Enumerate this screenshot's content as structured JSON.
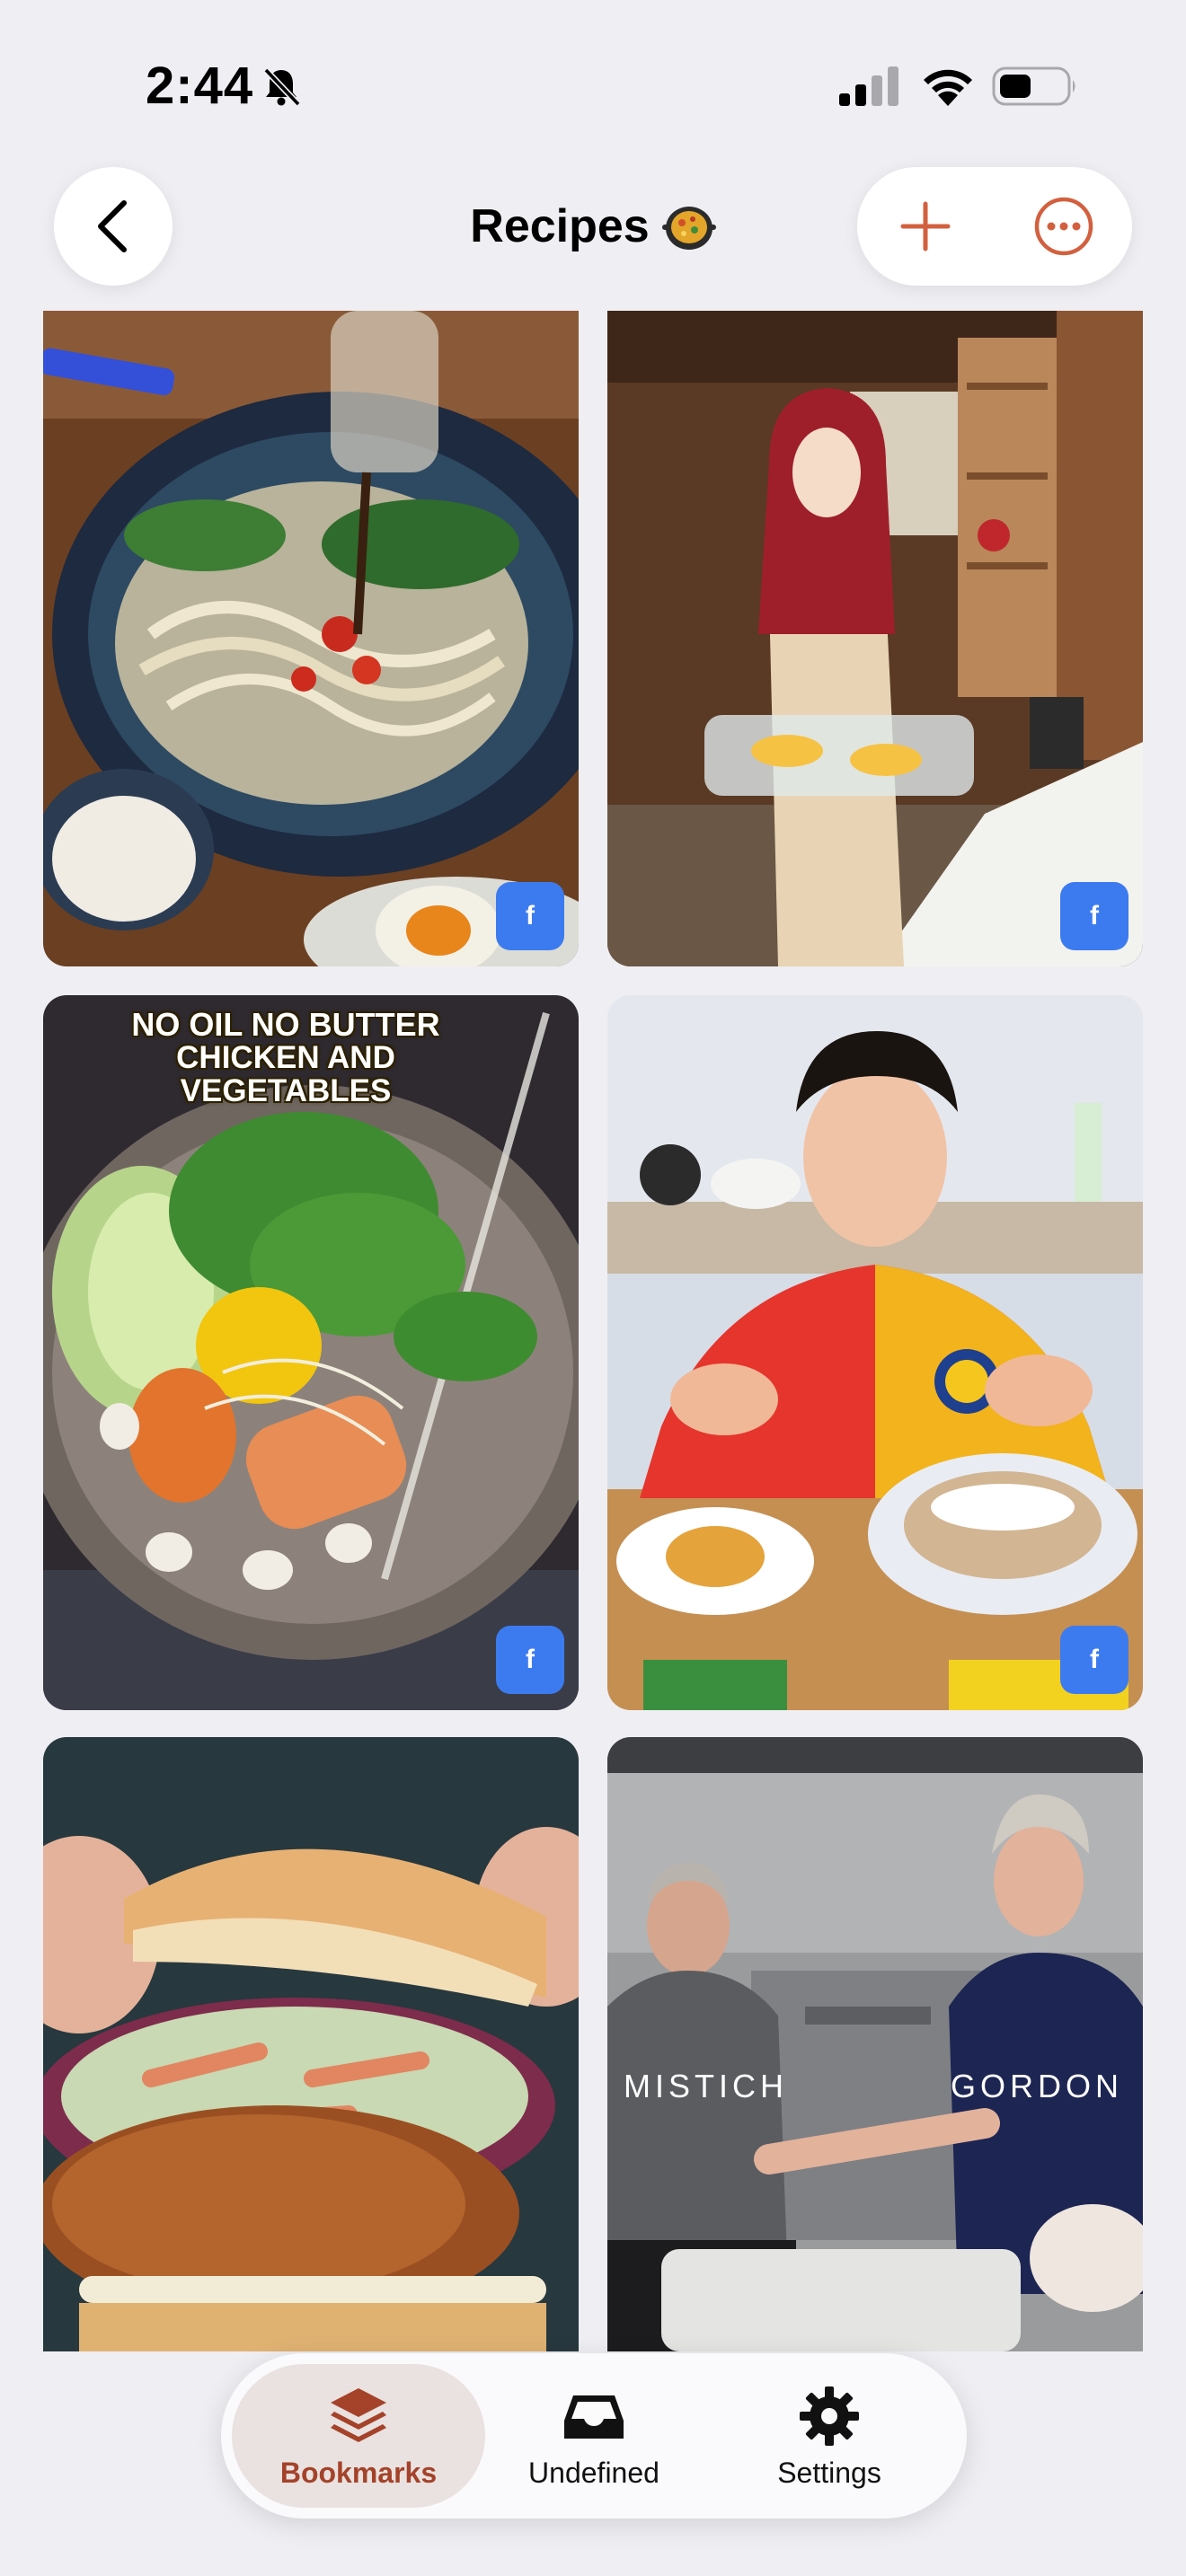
{
  "status_bar": {
    "time": "2:44",
    "icons": [
      "bell-slash-icon",
      "cellular-signal-icon",
      "wifi-icon",
      "battery-icon"
    ]
  },
  "header": {
    "title": "Recipes",
    "title_emoji": "paella-pan-emoji",
    "back_icon": "chevron-left-icon",
    "add_icon": "plus-icon",
    "more_icon": "ellipsis-circle-icon"
  },
  "grid": {
    "items": [
      {
        "description_icon": "noodle-soup-photo",
        "source_badge": "f"
      },
      {
        "description_icon": "woman-holding-fish-tray-photo",
        "source_badge": "f"
      },
      {
        "description_icon": "chicken-vegetable-pot-photo",
        "caption_line1": "NO OIL NO BUTTER",
        "caption_line2": "CHICKEN AND VEGETABLES",
        "source_badge": "f"
      },
      {
        "description_icon": "man-presenting-dishes-photo",
        "source_badge": "f"
      },
      {
        "description_icon": "fried-chicken-burger-photo"
      },
      {
        "description_icon": "two-chefs-kitchen-photo",
        "name_left": "MISTICH",
        "name_right": "GORDON"
      }
    ]
  },
  "tabbar": {
    "tabs": [
      {
        "label": "Bookmarks",
        "icon": "stack-layers-icon",
        "active": true
      },
      {
        "label": "Undefined",
        "icon": "tray-icon",
        "active": false
      },
      {
        "label": "Settings",
        "icon": "gear-icon",
        "active": false
      }
    ]
  },
  "colors": {
    "accent": "#d2603f",
    "active_tab_text": "#a4432a",
    "badge": "#3c7bef",
    "background": "#eeeef3"
  }
}
